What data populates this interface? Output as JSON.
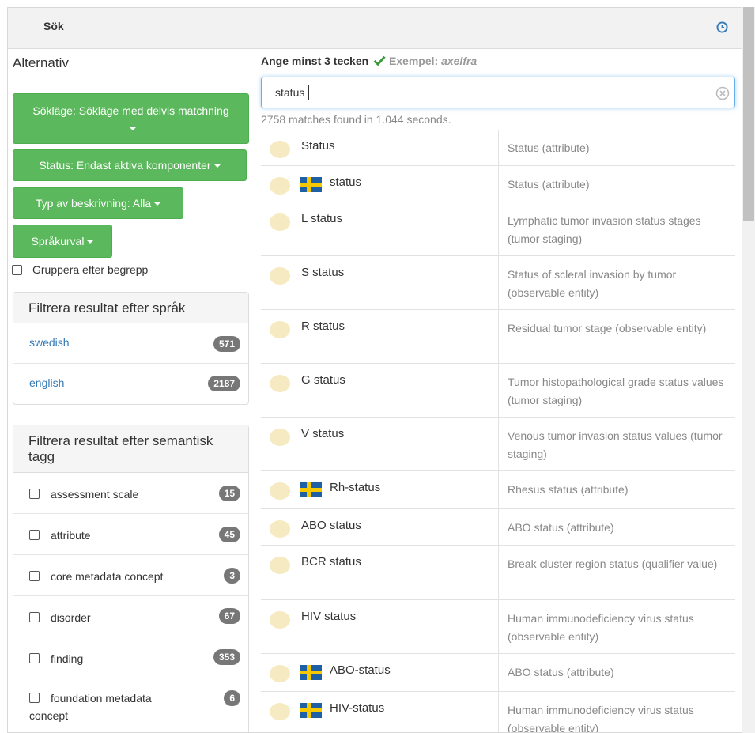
{
  "header": {
    "title": "Sök",
    "history_icon": "clock-icon"
  },
  "sidebar": {
    "title": "Alternativ",
    "buttons": {
      "search_mode": "Sökläge: Sökläge med delvis matchning",
      "status": "Status: Endast aktiva komponenter",
      "description_type": "Typ av beskrivning: Alla",
      "language": "Språkurval"
    },
    "group_by_concept": "Gruppera efter begrepp",
    "language_filter": {
      "title": "Filtrera resultat efter språk",
      "items": [
        {
          "label": "swedish",
          "count": "571"
        },
        {
          "label": "english",
          "count": "2187"
        }
      ]
    },
    "semantic_filter": {
      "title": "Filtrera resultat efter semantisk tagg",
      "items": [
        {
          "label": "assessment scale",
          "count": "15"
        },
        {
          "label": "attribute",
          "count": "45"
        },
        {
          "label": "core metadata concept",
          "count": "3"
        },
        {
          "label": "disorder",
          "count": "67"
        },
        {
          "label": "finding",
          "count": "353"
        },
        {
          "label": "foundation metadata concept",
          "count": "6"
        }
      ]
    }
  },
  "search": {
    "hint": "Ange minst 3 tecken",
    "example_label": "Exempel:",
    "example_value": "axelfra",
    "value": "status",
    "matches": "2758 matches found in 1.044 seconds."
  },
  "colors": {
    "accent": "#5cb85c",
    "link": "#337ab7",
    "badge": "#777777",
    "focus": "#66afe9"
  },
  "results": [
    {
      "term": "Status",
      "flag": false,
      "description": "Status (attribute)"
    },
    {
      "term": "status",
      "flag": true,
      "description": "Status (attribute)"
    },
    {
      "term": "L status",
      "flag": false,
      "description": "Lymphatic tumor invasion status stages (tumor staging)"
    },
    {
      "term": "S status",
      "flag": false,
      "description": "Status of scleral invasion by tumor (observable entity)"
    },
    {
      "term": "R status",
      "flag": false,
      "description": "Residual tumor stage (observable entity)"
    },
    {
      "term": "G status",
      "flag": false,
      "description": "Tumor histopathological grade status values (tumor staging)"
    },
    {
      "term": "V status",
      "flag": false,
      "description": "Venous tumor invasion status values (tumor staging)"
    },
    {
      "term": "Rh-status",
      "flag": true,
      "description": "Rhesus status (attribute)"
    },
    {
      "term": "ABO status",
      "flag": false,
      "description": "ABO status (attribute)"
    },
    {
      "term": "BCR status",
      "flag": false,
      "description": "Break cluster region status (qualifier value)"
    },
    {
      "term": "HIV status",
      "flag": false,
      "description": "Human immunodeficiency virus status (observable entity)"
    },
    {
      "term": "ABO-status",
      "flag": true,
      "description": "ABO status (attribute)"
    },
    {
      "term": "HIV-status",
      "flag": true,
      "description": "Human immunodeficiency virus status (observable entity)"
    }
  ]
}
